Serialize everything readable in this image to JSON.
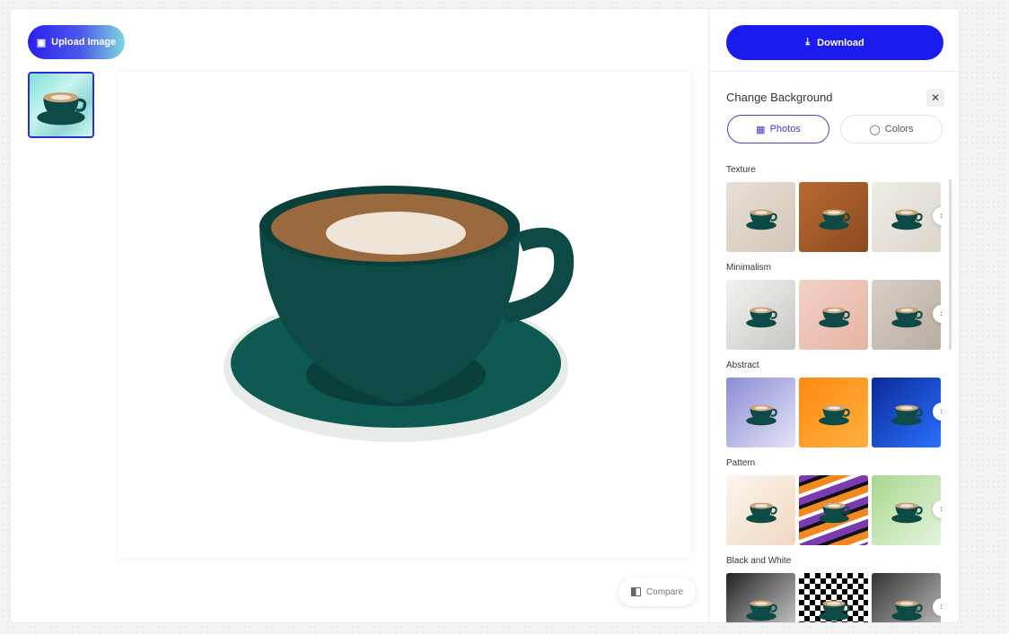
{
  "toolbar": {
    "upload_label": "Upload Image",
    "download_label": "Download",
    "compare_label": "Compare"
  },
  "panel": {
    "title": "Change Background",
    "tabs": [
      {
        "label": "Photos",
        "active": true
      },
      {
        "label": "Colors",
        "active": false
      }
    ]
  },
  "colors": {
    "accent": "#1b1bee",
    "cup": "#0d4a45"
  },
  "categories": [
    {
      "name": "Texture",
      "thumbs": [
        [
          "#e8e0d6",
          "#d2c6b8"
        ],
        [
          "#b86a32",
          "#8a4a20"
        ],
        [
          "#f0ece6",
          "#dcd6cc"
        ]
      ]
    },
    {
      "name": "Minimalism",
      "thumbs": [
        [
          "#f4f4f2",
          "#c8c6c2"
        ],
        [
          "#f2d2c6",
          "#e6b4a4"
        ],
        [
          "#d8d0c8",
          "#b8aca0"
        ]
      ]
    },
    {
      "name": "Abstract",
      "thumbs": [
        [
          "#8c8cd8",
          "#e4e4f4"
        ],
        [
          "#ff8a10",
          "#ffb040"
        ],
        [
          "#0a2a9a",
          "#2a70ff"
        ]
      ]
    },
    {
      "name": "Pattern",
      "thumbs": [
        [
          "#fbf6f0",
          "#f0d8c0"
        ],
        [
          "#7a3ab0",
          "#f08a20"
        ],
        [
          "#a8d890",
          "#e4f4dc"
        ]
      ]
    },
    {
      "name": "Black and White",
      "thumbs": [
        [
          "#222222",
          "#dddddd"
        ],
        [
          "#000000",
          "#ffffff"
        ],
        [
          "#333333",
          "#cccccc"
        ]
      ]
    }
  ]
}
